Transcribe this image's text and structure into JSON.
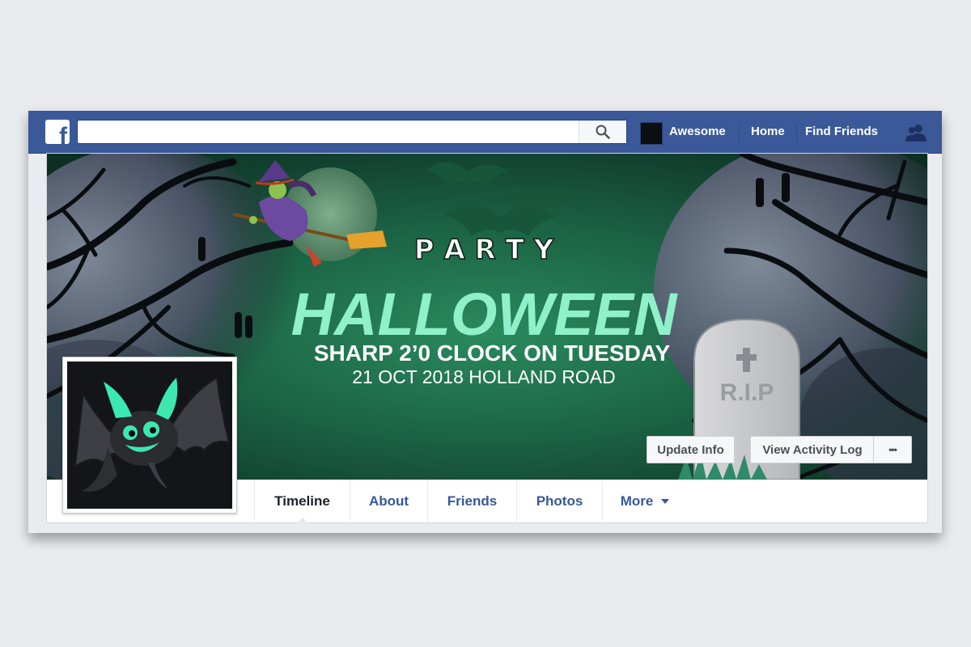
{
  "topbar": {
    "logo_letter": "f",
    "search": {
      "value": "",
      "placeholder": ""
    },
    "profile_name": "Awesome",
    "home": "Home",
    "find_friends": "Find Friends"
  },
  "cover": {
    "party": "P A R T Y",
    "halloween": "HALLOWEEN",
    "line1": "SHARP 2’0 CLOCK ON TUESDAY",
    "line2": "21 OCT 2018 HOLLAND ROAD",
    "tombstone": "R.I.P"
  },
  "actions": {
    "update_info": "Update Info",
    "view_activity_log": "View Activity Log",
    "more_dots": "•••"
  },
  "tabs": {
    "timeline": "Timeline",
    "about": "About",
    "friends": "Friends",
    "photos": "Photos",
    "more": "More"
  },
  "colors": {
    "brand_blue": "#3b5998",
    "link_blue": "#365899",
    "halloween_mint": "#8ff0c9",
    "cover_green": "#1f6f4d"
  }
}
